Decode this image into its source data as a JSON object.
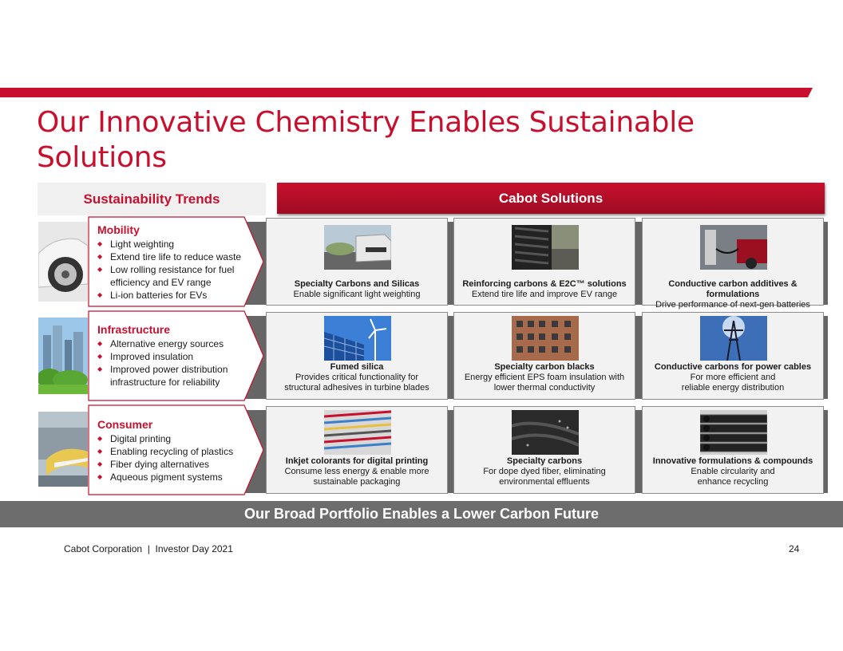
{
  "title": "Our Innovative Chemistry Enables Sustainable Solutions",
  "colors": {
    "brand_red": "#c8102e",
    "band_gray": "#666666",
    "bottom_bar_gray": "#6d6d6d"
  },
  "trends_header": "Sustainability Trends",
  "solutions_header": "Cabot Solutions",
  "trends": [
    {
      "name": "Mobility",
      "photo_icon": "car-icon",
      "bullets": [
        "Light weighting",
        "Extend tire life to reduce waste",
        "Low rolling resistance for fuel efficiency and EV range",
        "Li-ion batteries for EVs"
      ]
    },
    {
      "name": "Infrastructure",
      "photo_icon": "city-icon",
      "bullets": [
        "Alternative energy sources",
        "Improved insulation",
        "Improved power distribution infrastructure for reliability"
      ]
    },
    {
      "name": "Consumer",
      "photo_icon": "printer-icon",
      "bullets": [
        "Digital printing",
        "Enabling recycling of plastics",
        "Fiber dying alternatives",
        "Aqueous pigment systems"
      ]
    }
  ],
  "solutions": [
    [
      {
        "title": "Specialty Carbons and Silicas",
        "desc": [
          "Enable significant light weighting"
        ],
        "icon": "car-front-icon"
      },
      {
        "title": "Reinforcing carbons & E2C™ solutions",
        "desc": [
          "Extend tire life and improve EV range"
        ],
        "icon": "tire-icon"
      },
      {
        "title": "Conductive carbon additives & formulations",
        "desc": [
          "Drive performance of next-gen batteries"
        ],
        "icon": "ev-charging-icon"
      }
    ],
    [
      {
        "title": "Fumed silica",
        "desc": [
          "Provides critical functionality for",
          "structural adhesives in turbine blades"
        ],
        "icon": "wind-solar-icon"
      },
      {
        "title": "Specialty carbon blacks",
        "desc": [
          "Energy efficient EPS foam insulation with",
          "lower thermal conductivity"
        ],
        "icon": "building-icon"
      },
      {
        "title": "Conductive carbons for power cables",
        "desc": [
          "For more efficient and",
          "reliable energy distribution"
        ],
        "icon": "power-tower-icon"
      }
    ],
    [
      {
        "title": "Inkjet colorants for digital printing",
        "desc": [
          "Consume less energy & enable more",
          "sustainable packaging"
        ],
        "icon": "print-stack-icon"
      },
      {
        "title": "Specialty carbons",
        "desc": [
          "For dope dyed fiber, eliminating",
          "environmental effluents"
        ],
        "icon": "black-fabric-icon"
      },
      {
        "title": "Innovative formulations & compounds",
        "desc": [
          "Enable circularity and",
          "enhance recycling"
        ],
        "icon": "black-pipes-icon"
      }
    ]
  ],
  "bottom_banner": "Our Broad Portfolio Enables a Lower Carbon Future",
  "footer": {
    "left": "Cabot Corporation  |  Investor Day 2021",
    "page_number": "24"
  }
}
